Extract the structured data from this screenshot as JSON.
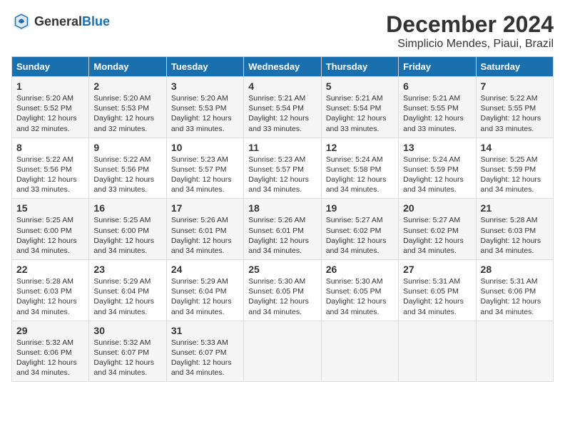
{
  "header": {
    "logo_general": "General",
    "logo_blue": "Blue",
    "title": "December 2024",
    "subtitle": "Simplicio Mendes, Piaui, Brazil"
  },
  "days_of_week": [
    "Sunday",
    "Monday",
    "Tuesday",
    "Wednesday",
    "Thursday",
    "Friday",
    "Saturday"
  ],
  "weeks": [
    [
      {
        "day": "1",
        "sunrise": "5:20 AM",
        "sunset": "5:52 PM",
        "daylight": "12 hours and 32 minutes."
      },
      {
        "day": "2",
        "sunrise": "5:20 AM",
        "sunset": "5:53 PM",
        "daylight": "12 hours and 32 minutes."
      },
      {
        "day": "3",
        "sunrise": "5:20 AM",
        "sunset": "5:53 PM",
        "daylight": "12 hours and 33 minutes."
      },
      {
        "day": "4",
        "sunrise": "5:21 AM",
        "sunset": "5:54 PM",
        "daylight": "12 hours and 33 minutes."
      },
      {
        "day": "5",
        "sunrise": "5:21 AM",
        "sunset": "5:54 PM",
        "daylight": "12 hours and 33 minutes."
      },
      {
        "day": "6",
        "sunrise": "5:21 AM",
        "sunset": "5:55 PM",
        "daylight": "12 hours and 33 minutes."
      },
      {
        "day": "7",
        "sunrise": "5:22 AM",
        "sunset": "5:55 PM",
        "daylight": "12 hours and 33 minutes."
      }
    ],
    [
      {
        "day": "8",
        "sunrise": "5:22 AM",
        "sunset": "5:56 PM",
        "daylight": "12 hours and 33 minutes."
      },
      {
        "day": "9",
        "sunrise": "5:22 AM",
        "sunset": "5:56 PM",
        "daylight": "12 hours and 33 minutes."
      },
      {
        "day": "10",
        "sunrise": "5:23 AM",
        "sunset": "5:57 PM",
        "daylight": "12 hours and 34 minutes."
      },
      {
        "day": "11",
        "sunrise": "5:23 AM",
        "sunset": "5:57 PM",
        "daylight": "12 hours and 34 minutes."
      },
      {
        "day": "12",
        "sunrise": "5:24 AM",
        "sunset": "5:58 PM",
        "daylight": "12 hours and 34 minutes."
      },
      {
        "day": "13",
        "sunrise": "5:24 AM",
        "sunset": "5:59 PM",
        "daylight": "12 hours and 34 minutes."
      },
      {
        "day": "14",
        "sunrise": "5:25 AM",
        "sunset": "5:59 PM",
        "daylight": "12 hours and 34 minutes."
      }
    ],
    [
      {
        "day": "15",
        "sunrise": "5:25 AM",
        "sunset": "6:00 PM",
        "daylight": "12 hours and 34 minutes."
      },
      {
        "day": "16",
        "sunrise": "5:25 AM",
        "sunset": "6:00 PM",
        "daylight": "12 hours and 34 minutes."
      },
      {
        "day": "17",
        "sunrise": "5:26 AM",
        "sunset": "6:01 PM",
        "daylight": "12 hours and 34 minutes."
      },
      {
        "day": "18",
        "sunrise": "5:26 AM",
        "sunset": "6:01 PM",
        "daylight": "12 hours and 34 minutes."
      },
      {
        "day": "19",
        "sunrise": "5:27 AM",
        "sunset": "6:02 PM",
        "daylight": "12 hours and 34 minutes."
      },
      {
        "day": "20",
        "sunrise": "5:27 AM",
        "sunset": "6:02 PM",
        "daylight": "12 hours and 34 minutes."
      },
      {
        "day": "21",
        "sunrise": "5:28 AM",
        "sunset": "6:03 PM",
        "daylight": "12 hours and 34 minutes."
      }
    ],
    [
      {
        "day": "22",
        "sunrise": "5:28 AM",
        "sunset": "6:03 PM",
        "daylight": "12 hours and 34 minutes."
      },
      {
        "day": "23",
        "sunrise": "5:29 AM",
        "sunset": "6:04 PM",
        "daylight": "12 hours and 34 minutes."
      },
      {
        "day": "24",
        "sunrise": "5:29 AM",
        "sunset": "6:04 PM",
        "daylight": "12 hours and 34 minutes."
      },
      {
        "day": "25",
        "sunrise": "5:30 AM",
        "sunset": "6:05 PM",
        "daylight": "12 hours and 34 minutes."
      },
      {
        "day": "26",
        "sunrise": "5:30 AM",
        "sunset": "6:05 PM",
        "daylight": "12 hours and 34 minutes."
      },
      {
        "day": "27",
        "sunrise": "5:31 AM",
        "sunset": "6:05 PM",
        "daylight": "12 hours and 34 minutes."
      },
      {
        "day": "28",
        "sunrise": "5:31 AM",
        "sunset": "6:06 PM",
        "daylight": "12 hours and 34 minutes."
      }
    ],
    [
      {
        "day": "29",
        "sunrise": "5:32 AM",
        "sunset": "6:06 PM",
        "daylight": "12 hours and 34 minutes."
      },
      {
        "day": "30",
        "sunrise": "5:32 AM",
        "sunset": "6:07 PM",
        "daylight": "12 hours and 34 minutes."
      },
      {
        "day": "31",
        "sunrise": "5:33 AM",
        "sunset": "6:07 PM",
        "daylight": "12 hours and 34 minutes."
      },
      {
        "day": "",
        "sunrise": "",
        "sunset": "",
        "daylight": ""
      },
      {
        "day": "",
        "sunrise": "",
        "sunset": "",
        "daylight": ""
      },
      {
        "day": "",
        "sunrise": "",
        "sunset": "",
        "daylight": ""
      },
      {
        "day": "",
        "sunrise": "",
        "sunset": "",
        "daylight": ""
      }
    ]
  ]
}
